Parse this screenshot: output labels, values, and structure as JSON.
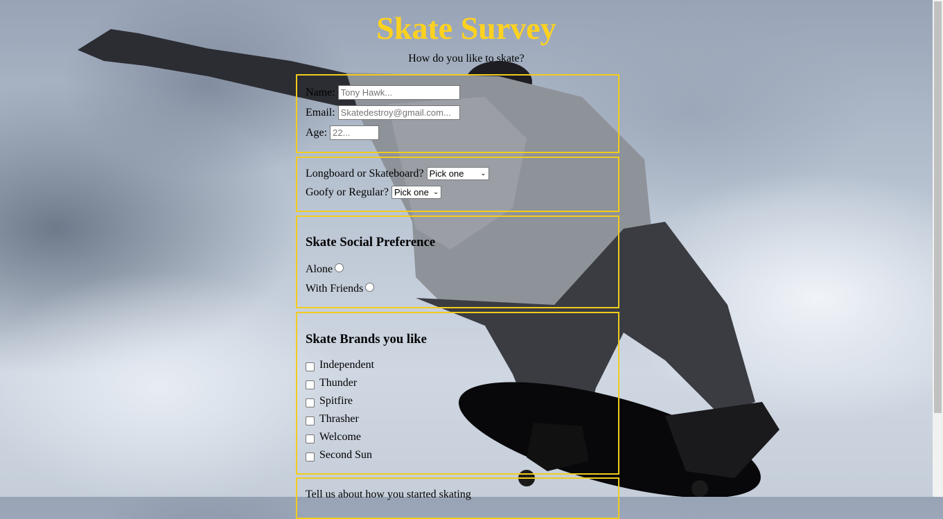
{
  "title": "Skate Survey",
  "subtitle": "How do you like to skate?",
  "personal": {
    "name_label": "Name:",
    "name_placeholder": "Tony Hawk...",
    "email_label": "Email:",
    "email_placeholder": "Skatedestroy@gmail.com...",
    "age_label": "Age:",
    "age_placeholder": "22..."
  },
  "board": {
    "board_label": "Longboard or Skateboard?",
    "board_value": "Pick one",
    "stance_label": "Goofy or Regular?",
    "stance_value": "Pick one"
  },
  "social": {
    "heading": "Skate Social Preference",
    "options": [
      "Alone",
      "With Friends"
    ]
  },
  "brands": {
    "heading": "Skate Brands you like",
    "options": [
      "Independent",
      "Thunder",
      "Spitfire",
      "Thrasher",
      "Welcome",
      "Second Sun"
    ]
  },
  "story": {
    "prompt": "Tell us about how you started skating"
  },
  "colors": {
    "title": "#ffd21f",
    "border": "#f2cc1c"
  }
}
